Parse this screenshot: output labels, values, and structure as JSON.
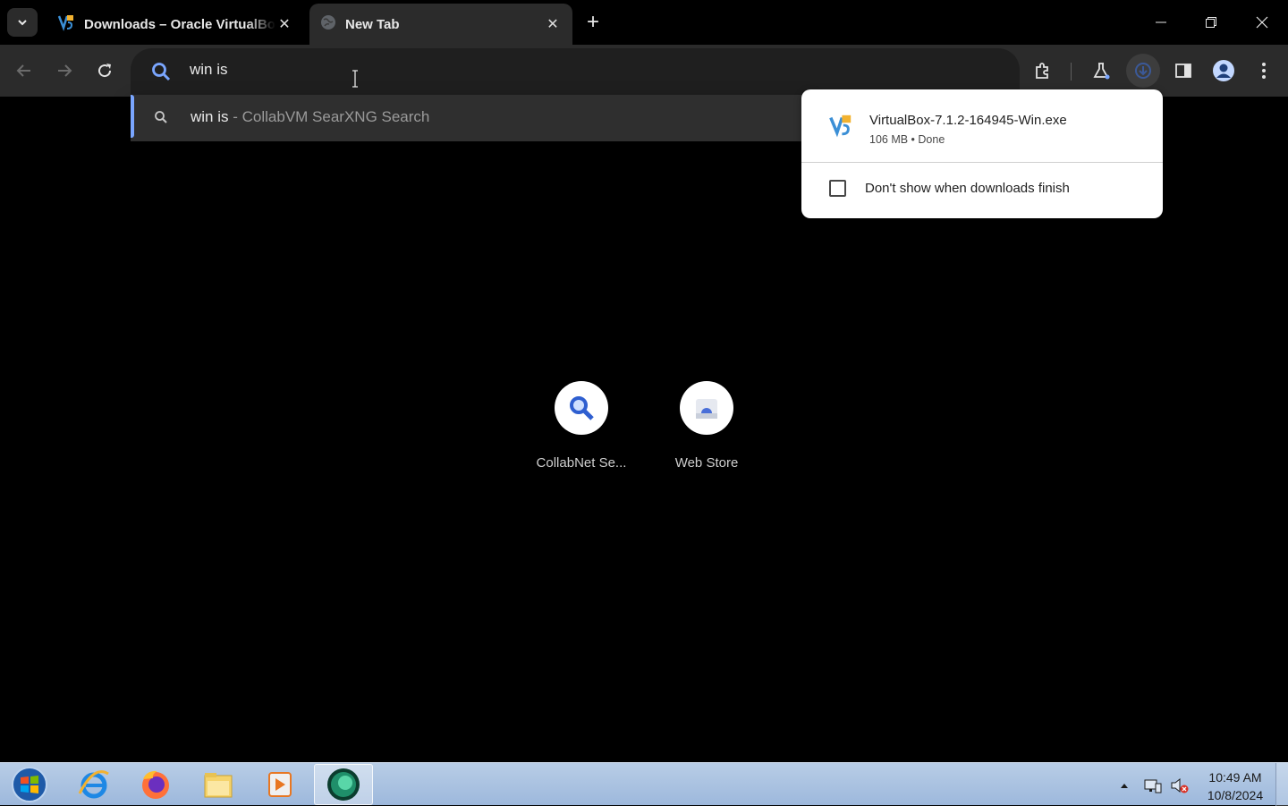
{
  "tabs": [
    {
      "title": "Downloads – Oracle VirtualBox",
      "icon": "virtualbox-icon",
      "active": false
    },
    {
      "title": "New Tab",
      "icon": "globe-icon",
      "active": true
    }
  ],
  "omnibox": {
    "value": "win is"
  },
  "suggestion": {
    "query": "win is",
    "source": " - CollabVM SearXNG Search"
  },
  "download_panel": {
    "file_name": "VirtualBox-7.1.2-164945-Win.exe",
    "meta": "106 MB • Done",
    "checkbox_label": "Don't show when downloads finish",
    "checked": false
  },
  "shortcuts": [
    {
      "label": "CollabNet Se...",
      "icon": "search-icon"
    },
    {
      "label": "Web Store",
      "icon": "web-store-icon"
    }
  ],
  "taskbar": {
    "apps": [
      "start-button",
      "internet-explorer-icon",
      "firefox-icon",
      "file-explorer-icon",
      "media-player-icon",
      "chrome-icon"
    ],
    "time": "10:49 AM",
    "date": "10/8/2024"
  },
  "colors": {
    "accent": "#7aa6ff",
    "toolbar": "#2b2b2b",
    "omnibox": "#1f1f1f"
  }
}
